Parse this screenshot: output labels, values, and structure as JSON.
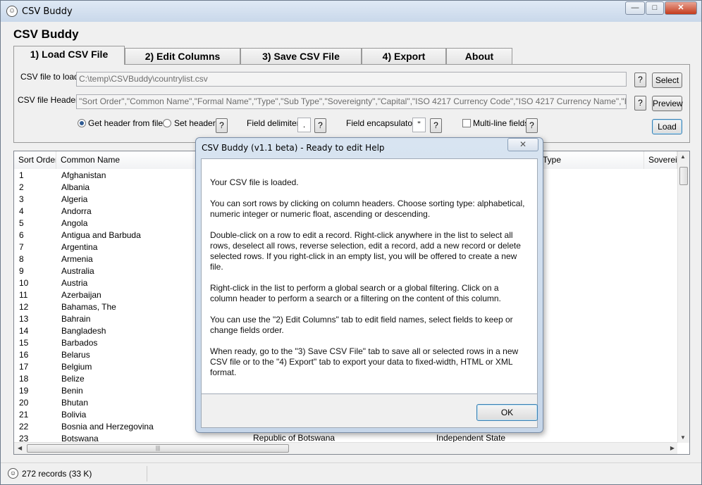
{
  "window": {
    "title": "CSV Buddy",
    "controls": {
      "minimize": "—",
      "maximize": "□",
      "close": "✕"
    }
  },
  "app_title": "CSV Buddy",
  "tabs": [
    {
      "label": "1) Load CSV File",
      "active": true
    },
    {
      "label": "2) Edit Columns",
      "active": false
    },
    {
      "label": "3) Save CSV File",
      "active": false
    },
    {
      "label": "4) Export",
      "active": false
    },
    {
      "label": "About",
      "active": false
    }
  ],
  "load_panel": {
    "file_label": "CSV file to load:",
    "file_value": "C:\\temp\\CSVBuddy\\countrylist.csv",
    "header_label": "CSV file Header:",
    "header_value": "\"Sort Order\",\"Common Name\",\"Formal Name\",\"Type\",\"Sub Type\",\"Sovereignty\",\"Capital\",\"ISO 4217 Currency Code\",\"ISO 4217 Currency Name\",\"ITU-T Telephone",
    "help": "?",
    "select_label": "Select",
    "preview_label": "Preview",
    "load_label": "Load",
    "radio_get_header": "Get header from  file",
    "radio_set_header": "Set header",
    "delimiter_label": "Field delimiter:",
    "delimiter_value": ".",
    "encapsulator_label": "Field encapsulator:",
    "encapsulator_value": "\"",
    "multiline_label": "Multi-line fields"
  },
  "list": {
    "columns": [
      "Sort Order",
      "Common Name",
      "Type",
      "Sovereig"
    ],
    "rows": [
      [
        "1",
        "Afghanistan"
      ],
      [
        "2",
        "Albania"
      ],
      [
        "3",
        "Algeria"
      ],
      [
        "4",
        "Andorra"
      ],
      [
        "5",
        "Angola"
      ],
      [
        "6",
        "Antigua and Barbuda"
      ],
      [
        "7",
        "Argentina"
      ],
      [
        "8",
        "Armenia"
      ],
      [
        "9",
        "Australia"
      ],
      [
        "10",
        "Austria"
      ],
      [
        "11",
        "Azerbaijan"
      ],
      [
        "12",
        "Bahamas, The"
      ],
      [
        "13",
        "Bahrain"
      ],
      [
        "14",
        "Bangladesh"
      ],
      [
        "15",
        "Barbados"
      ],
      [
        "16",
        "Belarus"
      ],
      [
        "17",
        "Belgium"
      ],
      [
        "18",
        "Belize"
      ],
      [
        "19",
        "Benin"
      ],
      [
        "20",
        "Bhutan"
      ],
      [
        "21",
        "Bolivia"
      ],
      [
        "22",
        "Bosnia and Herzegovina"
      ],
      [
        "23",
        "Botswana"
      ]
    ],
    "row23_formal": "Republic of Botswana",
    "row23_type": "Independent State",
    "hscroll_grip": "|||"
  },
  "status": {
    "records": "272 records (33 K)"
  },
  "dialog": {
    "title": "CSV Buddy (v1.1 beta) - Ready to edit Help",
    "close": "✕",
    "paragraphs": [
      "Your CSV file is loaded.",
      "You can sort rows by clicking on column headers. Choose sorting type: alphabetical, numeric integer or numeric float, ascending or descending.",
      "Double-click on a row to edit a record.  Right-click anywhere in the list to select all rows, deselect all rows, reverse selection, edit a record, add a new record or delete selected rows. If you right-click in an empty list, you will be offered to create a new file.",
      "Right-click in the list to perform a global search or a global filtering. Click on a column header to perform a search or a filtering on the content of this column.",
      "You can use the \"2) Edit Columns\" tab to edit field names, select fields to keep or change fields order.",
      "When ready, go to the \"3) Save CSV File\" tab to save all or selected rows in a new CSV file or to the \"4) Export\" tab to export your data to fixed-width, HTML or XML format."
    ],
    "ok_label": "OK"
  }
}
